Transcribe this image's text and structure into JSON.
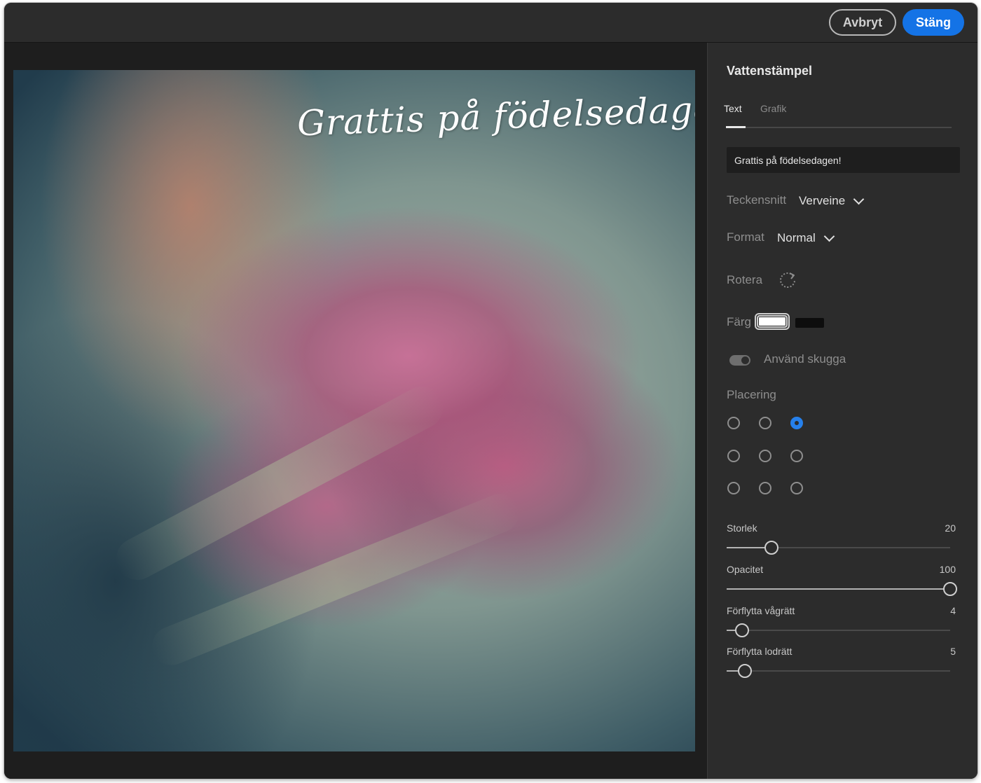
{
  "topbar": {
    "cancel_label": "Avbryt",
    "close_label": "Stäng"
  },
  "canvas": {
    "watermark_text": "Grattis på  födelsedagen!"
  },
  "panel": {
    "title": "Vattenstämpel",
    "tabs": [
      {
        "label": "Text",
        "active": true
      },
      {
        "label": "Grafik",
        "active": false
      }
    ],
    "text_input_value": "Grattis på  födelsedagen!",
    "font_label": "Teckensnitt",
    "font_value": "Verveine",
    "format_label": "Format",
    "format_value": "Normal",
    "rotate_label": "Rotera",
    "rotate_icon": "rotate-icon",
    "color_label": "Färg",
    "colors": {
      "white": "#ffffff",
      "black": "#0d0d0d",
      "accent": "#1473e6"
    },
    "shadow_label": "Använd skugga",
    "shadow_enabled": true,
    "placement_label": "Placering",
    "placement_selected": "top-right",
    "sliders": [
      {
        "label": "Storlek",
        "value": "20",
        "fraction": 0.2
      },
      {
        "label": "Opacitet",
        "value": "100",
        "fraction": 1.0
      },
      {
        "label": "Förflytta vågrätt",
        "value": "4",
        "fraction": 0.07
      },
      {
        "label": "Förflytta lodrätt",
        "value": "5",
        "fraction": 0.08
      }
    ]
  }
}
